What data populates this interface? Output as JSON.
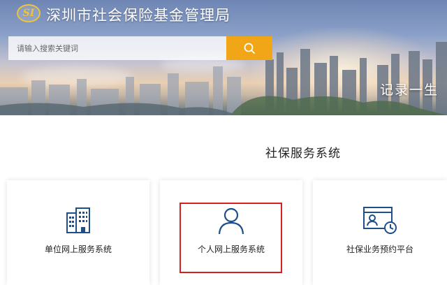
{
  "header": {
    "logo_text": "SI",
    "site_title": "深圳市社会保险基金管理局",
    "slogan": "记录一生"
  },
  "search": {
    "placeholder": "请输入搜索关键词",
    "button_icon": "search-icon"
  },
  "section": {
    "title": "社保服务系统"
  },
  "cards": [
    {
      "label": "单位网上服务系统",
      "icon": "building-icon"
    },
    {
      "label": "个人网上服务系统",
      "icon": "user-icon"
    },
    {
      "label": "社保业务预约平台",
      "icon": "appointment-icon"
    }
  ],
  "colors": {
    "accent": "#f0a616",
    "icon_blue": "#1e4e8c",
    "highlight": "#d61f1f"
  }
}
